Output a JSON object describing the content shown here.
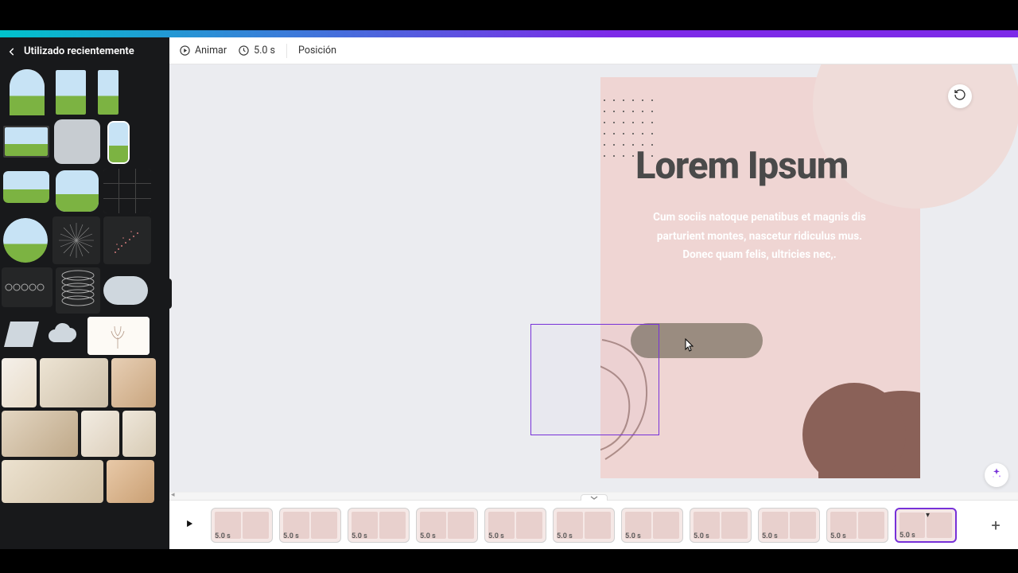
{
  "sidebar": {
    "title": "Utilizado recientemente"
  },
  "toolbar": {
    "animate": "Animar",
    "duration": "5.0 s",
    "position": "Posición"
  },
  "canvas": {
    "title": "Lorem Ipsum",
    "body": "Cum sociis natoque penatibus et magnis dis parturient montes, nascetur ridiculus mus. Donec quam felis, ultricies nec,."
  },
  "timeline": {
    "slides": [
      {
        "duration": "5.0 s"
      },
      {
        "duration": "5.0 s"
      },
      {
        "duration": "5.0 s"
      },
      {
        "duration": "5.0 s"
      },
      {
        "duration": "5.0 s"
      },
      {
        "duration": "5.0 s"
      },
      {
        "duration": "5.0 s"
      },
      {
        "duration": "5.0 s"
      },
      {
        "duration": "5.0 s"
      },
      {
        "duration": "5.0 s"
      },
      {
        "duration": "5.0 s"
      }
    ],
    "active_index": 10
  }
}
